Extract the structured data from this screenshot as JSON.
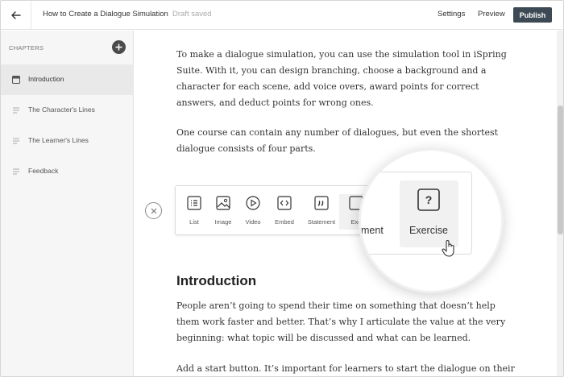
{
  "header": {
    "title": "How to Create a Dialogue Simulation",
    "status": "Draft saved",
    "settings": "Settings",
    "preview": "Preview",
    "publish": "Publish"
  },
  "sidebar": {
    "label": "CHAPTERS",
    "items": [
      {
        "label": "Introduction",
        "icon": "chapter-active-icon"
      },
      {
        "label": "The Character's Lines",
        "icon": "lines-icon"
      },
      {
        "label": "The Learner's Lines",
        "icon": "lines-icon"
      },
      {
        "label": "Feedback",
        "icon": "lines-icon"
      }
    ]
  },
  "content": {
    "p1": "To make a dialogue simulation, you can use the simulation tool in iSpring Suite. With it, you can design branching, choose a background and a character for each scene, add voice overs, award points for correct answers, and deduct points for wrong ones.",
    "p2": "One course can contain any number of dialogues, but even the shortest dialogue consists of four parts.",
    "heading": "Introduction",
    "p3": "People aren’t going to spend their time on something that doesn’t help them work faster and better. That’s why I articulate the value at the very beginning: what topic will be discussed and what can be learned.",
    "p4": "Add a start button. It’s important for learners to start the dialogue on their own,"
  },
  "toolbar": {
    "items": [
      {
        "label": "List"
      },
      {
        "label": "Image"
      },
      {
        "label": "Video"
      },
      {
        "label": "Embed"
      },
      {
        "label": "Statement"
      },
      {
        "label": "Exe"
      }
    ]
  },
  "magnifier": {
    "partial_label": "ment",
    "exercise_label": "Exercise",
    "exercise_icon": "?"
  },
  "colors": {
    "publish_bg": "#3d4a55",
    "sidebar_bg": "#f6f6f6",
    "active_item_bg": "#e9e9e9"
  }
}
